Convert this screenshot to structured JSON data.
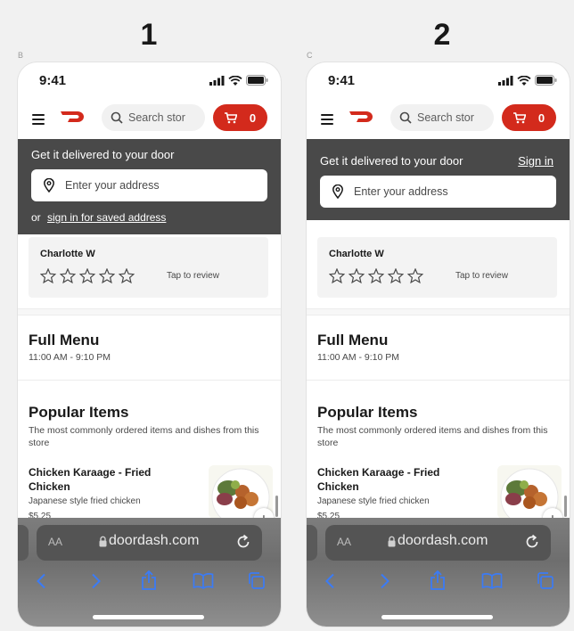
{
  "labels": {
    "variant_1": "1",
    "variant_2": "2",
    "letter_1": "B",
    "letter_2": "C"
  },
  "status": {
    "time": "9:41"
  },
  "header": {
    "search_placeholder": "Search stor",
    "cart_count": "0"
  },
  "banner": {
    "title": "Get it delivered to your door",
    "sign_in": "Sign in",
    "address_placeholder": "Enter your address",
    "or_text": "or",
    "saved_link": "sign in for saved address"
  },
  "review": {
    "name": "Charlotte W",
    "tap": "Tap to review",
    "stars": 5
  },
  "full_menu": {
    "title": "Full Menu",
    "hours": "11:00 AM - 9:10 PM"
  },
  "popular": {
    "title": "Popular Items",
    "description": "The most commonly ordered items and dishes from this store",
    "item": {
      "name": "Chicken Karaage - Fried Chicken",
      "description": "Japanese style fried chicken",
      "price": "$5.25"
    }
  },
  "safari": {
    "text_size": "AA",
    "domain": "doordash.com"
  },
  "colors": {
    "brand_red": "#d32a1c",
    "banner": "#494949",
    "ios_blue": "#3b7bf5"
  }
}
